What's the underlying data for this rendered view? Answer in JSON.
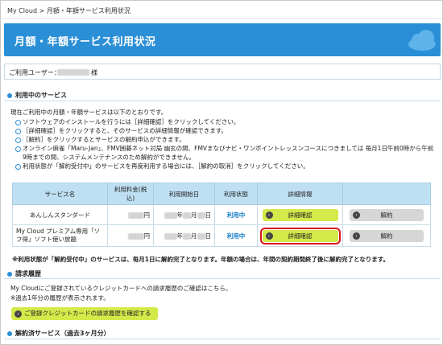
{
  "breadcrumb": {
    "home": "My Cloud",
    "separator": ">",
    "current": "月額・年額サービス利用状況"
  },
  "banner": {
    "title": "月額・年額サービス利用状況",
    "cloud_icon": "cloud-icon"
  },
  "user": {
    "label": "ご利用ユーザー：",
    "suffix": "様"
  },
  "section_active": {
    "heading": "利用中のサービス",
    "intro": "現在ご利用中の月額・年額サービスは以下のとおりです。",
    "bullets": [
      "ソフトウェアのインストールを行うには［詳細確認］をクリックしてください。",
      "［詳細確認］をクリックすると、そのサービスの詳細情報が確認できます。",
      "［解約］をクリックするとサービスの解約申込ができます。",
      "オンライン麻雀「Maru-Jan」、FMV囲碁ネット対局 幽玄の間、FMVまなびナビ・ワンポイントレッスンコースにつきましては 毎月1日午前0時から午前9時までの間、システムメンテナンスのため解約ができません。",
      "利用状態が「解約受付中」のサービスを再度利用する場合には、［解約の取消］をクリックしてください。"
    ]
  },
  "table": {
    "headers": [
      "サービス名",
      "利用料金(税込)",
      "利用開始日",
      "利用状態",
      "詳細情報",
      ""
    ],
    "rows": [
      {
        "name": "あんしんスタンダード",
        "price_unit": "円",
        "date_year": "年",
        "date_month": "月",
        "date_day": "日",
        "status": "利用中",
        "detail_label": "詳細確認",
        "cancel_label": "解約"
      },
      {
        "name": "My Cloud プレミアム専用「ソフ得」ソフト使い放題",
        "price_unit": "円",
        "date_year": "年",
        "date_month": "月",
        "date_day": "日",
        "status": "利用中",
        "detail_label": "詳細確認",
        "cancel_label": "解約"
      }
    ]
  },
  "notice": "※利用状態が「解約受付中」のサービスは、毎月1日に解約完了となります。年額の場合は、年間の契約期間終了後に解約完了となります。",
  "section_billing": {
    "heading": "請求履歴",
    "text1": "My Cloudにご登録されているクレジットカードへの請求履歴のご確認はこちら。",
    "text2": "※過去1年分の履歴が表示されます。",
    "button_label": "ご登録クレジットカードの請求履歴を確認する"
  },
  "section_cancelled": {
    "heading": "解約済サービス（過去3ヶ月分）"
  },
  "colors": {
    "accent": "#2a8fd6",
    "button_primary": "#d4e94a",
    "button_secondary": "#d6d6d6",
    "highlight": "#d9141c",
    "table_header": "#bfe0f3"
  }
}
